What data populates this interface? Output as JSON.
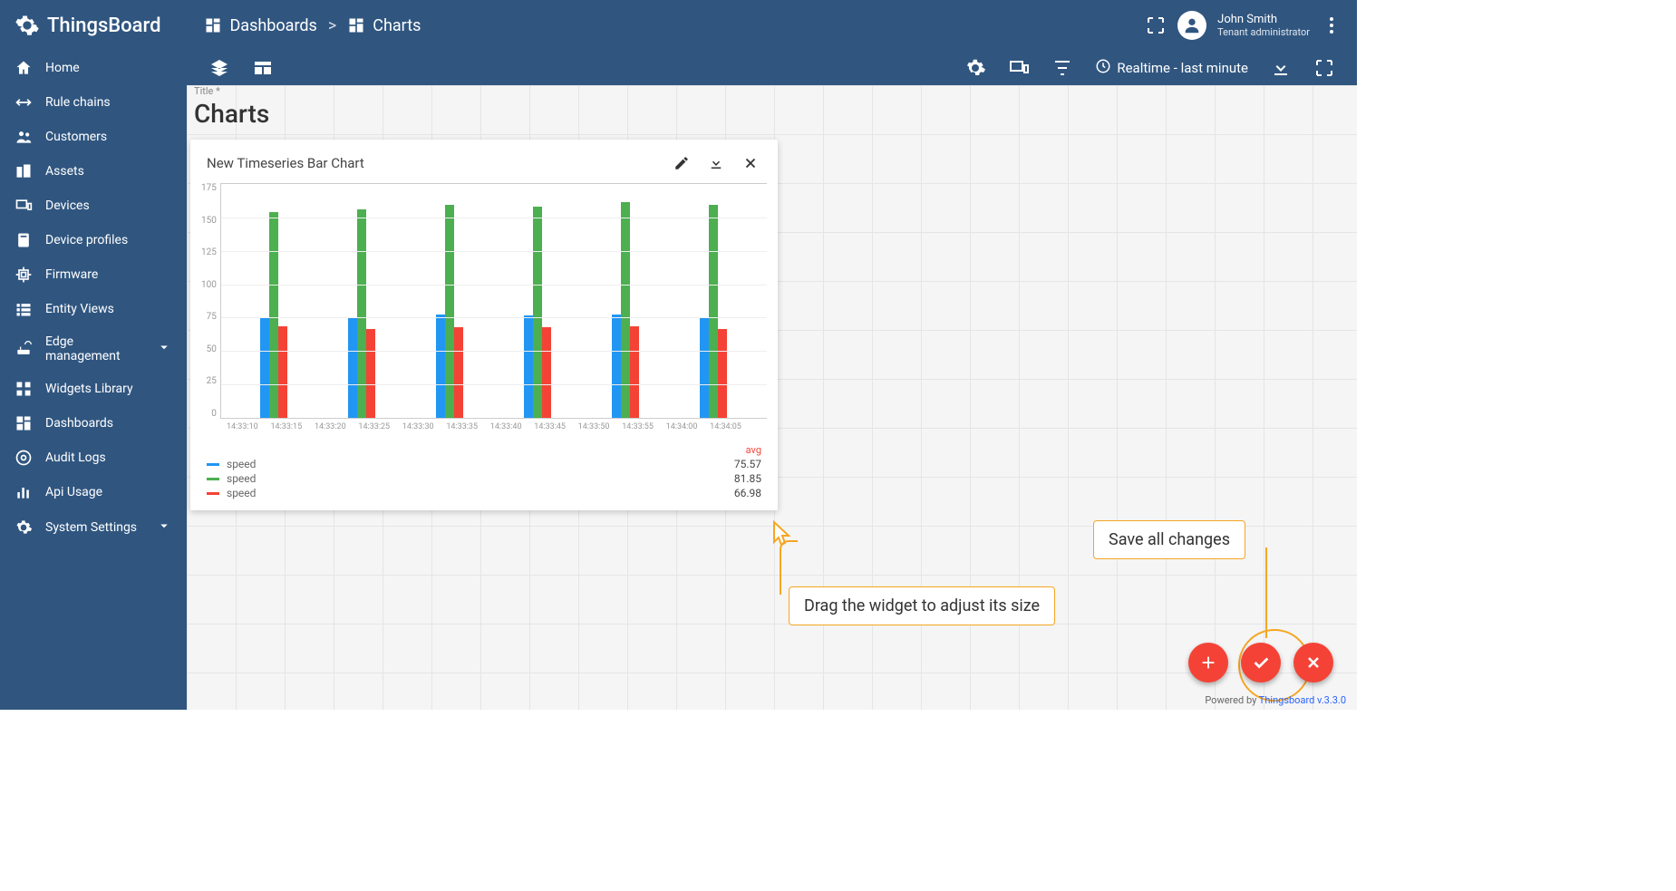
{
  "brand": "ThingsBoard",
  "breadcrumb": {
    "root": "Dashboards",
    "current": "Charts"
  },
  "user": {
    "name": "John Smith",
    "role": "Tenant administrator"
  },
  "sidebar": {
    "items": [
      {
        "label": "Home"
      },
      {
        "label": "Rule chains"
      },
      {
        "label": "Customers"
      },
      {
        "label": "Assets"
      },
      {
        "label": "Devices"
      },
      {
        "label": "Device profiles"
      },
      {
        "label": "Firmware"
      },
      {
        "label": "Entity Views"
      },
      {
        "label": "Edge management",
        "expandable": true
      },
      {
        "label": "Widgets Library"
      },
      {
        "label": "Dashboards"
      },
      {
        "label": "Audit Logs"
      },
      {
        "label": "Api Usage"
      },
      {
        "label": "System Settings",
        "expandable": true
      }
    ]
  },
  "toolbar": {
    "time_label": "Realtime - last minute"
  },
  "dashboard": {
    "title_label": "Title *",
    "title": "Charts"
  },
  "widget": {
    "title": "New Timeseries Bar Chart"
  },
  "chart_data": {
    "type": "bar",
    "ylim": [
      0,
      175
    ],
    "y_ticks": [
      175,
      150,
      125,
      100,
      75,
      50,
      25,
      0
    ],
    "x_ticks": [
      "14:33:10",
      "14:33:15",
      "14:33:20",
      "14:33:25",
      "14:33:30",
      "14:33:35",
      "14:33:40",
      "14:33:45",
      "14:33:50",
      "14:33:55",
      "14:34:00",
      "14:34:05"
    ],
    "series": [
      {
        "name": "speed",
        "color": "#2196f3",
        "avg": 75.57
      },
      {
        "name": "speed",
        "color": "#4caf50",
        "avg": 81.85
      },
      {
        "name": "speed",
        "color": "#f44336",
        "avg": 66.98
      }
    ],
    "groups": [
      {
        "x": "14:33:12",
        "blue": 75,
        "green": 153,
        "red": 68
      },
      {
        "x": "14:33:22",
        "blue": 74,
        "green": 155,
        "red": 66
      },
      {
        "x": "14:33:32",
        "blue": 77,
        "green": 158,
        "red": 67
      },
      {
        "x": "14:33:42",
        "blue": 76,
        "green": 157,
        "red": 67
      },
      {
        "x": "14:33:52",
        "blue": 77,
        "green": 160,
        "red": 68
      },
      {
        "x": "14:34:02",
        "blue": 75,
        "green": 158,
        "red": 66
      }
    ],
    "legend_header": "avg"
  },
  "callouts": {
    "drag": "Drag the widget to adjust its size",
    "save": "Save all changes"
  },
  "footer": {
    "prefix": "Powered by ",
    "link": "Thingsboard v.3.3.0"
  }
}
